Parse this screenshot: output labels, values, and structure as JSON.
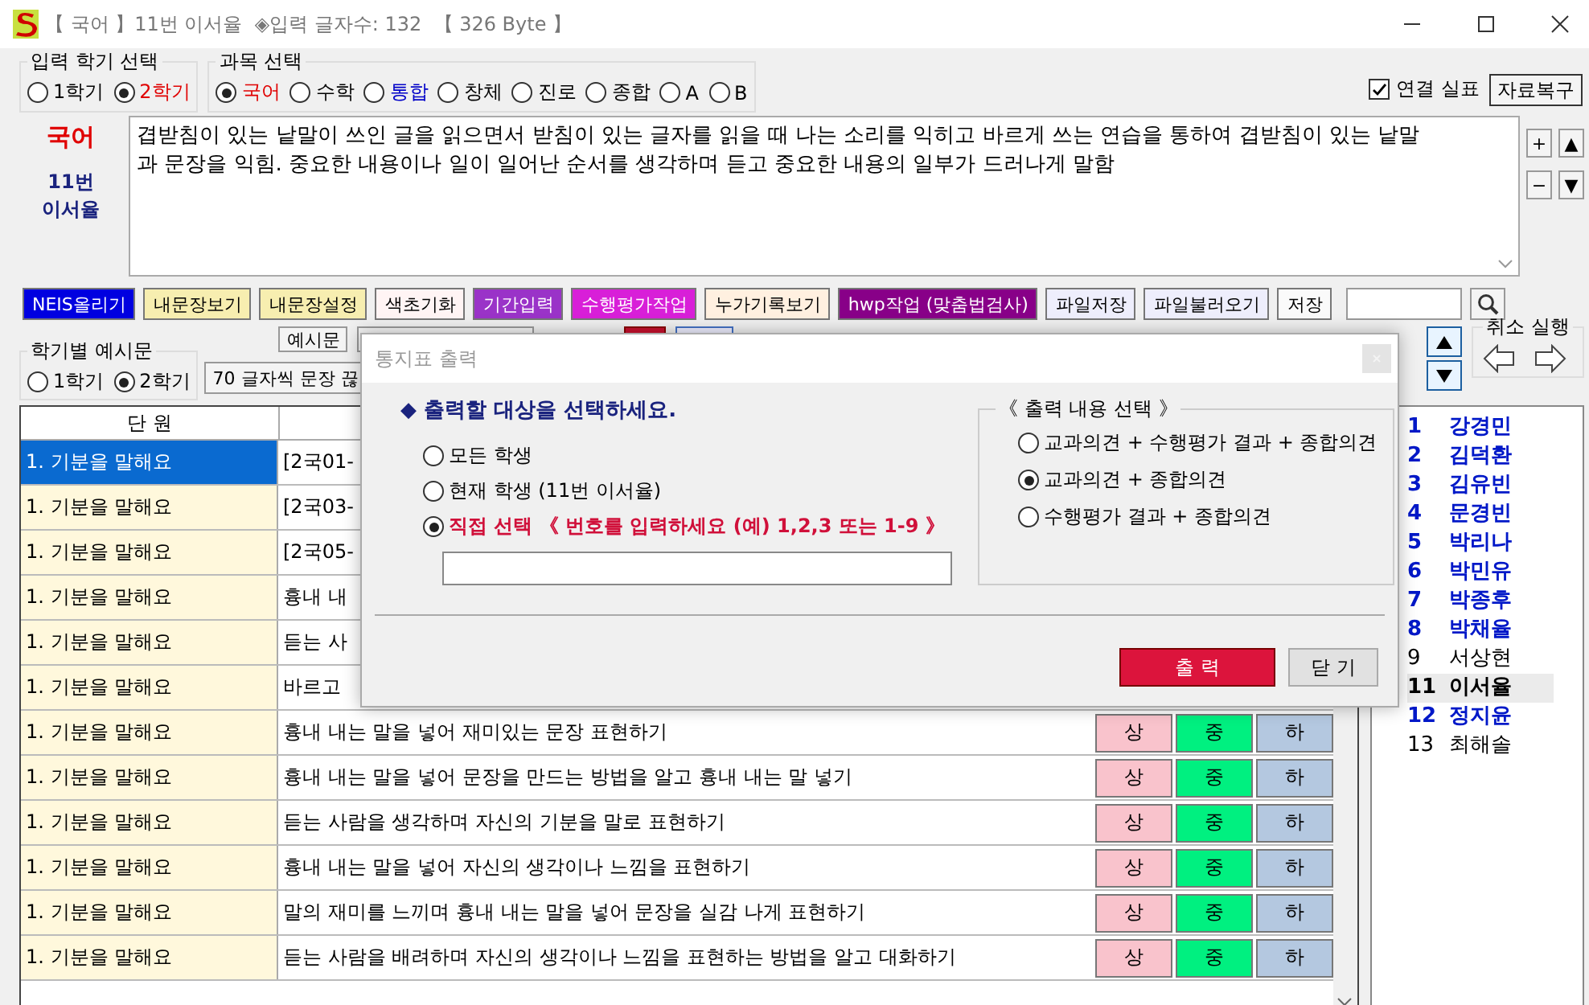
{
  "window": {
    "title": "【 국어 】11번 이서율  ◈입력 글자수: 132  【 326 Byte 】"
  },
  "semester": {
    "label": "입력 학기 선택",
    "options": [
      {
        "label": "1학기",
        "selected": false
      },
      {
        "label": "2학기",
        "selected": true
      }
    ]
  },
  "subjects": {
    "label": "과목 선택",
    "options": [
      {
        "label": "국어",
        "selected": true,
        "color": "#e00000"
      },
      {
        "label": "수학",
        "selected": false,
        "color": "#000000"
      },
      {
        "label": "통합",
        "selected": false,
        "color": "#0000c8"
      },
      {
        "label": "창체",
        "selected": false,
        "color": "#000000"
      },
      {
        "label": "진로",
        "selected": false,
        "color": "#000000"
      },
      {
        "label": "종합",
        "selected": false,
        "color": "#000000"
      },
      {
        "label": "A",
        "selected": false,
        "color": "#000000"
      },
      {
        "label": "B",
        "selected": false,
        "color": "#000000"
      }
    ]
  },
  "link_checkbox": {
    "label": "연결 실표",
    "checked": true
  },
  "restore_button": "자료복구",
  "editor": {
    "subject": "국어",
    "student_number": "11번",
    "student_name": "이서율",
    "text": "겹받침이 있는 낱말이 쓰인 글을 읽으면서 받침이 있는 글자를 읽을 때 나는 소리를 익히고 바르게 쓰는 연습을 통하여 겹받침이 있는 낱말과 문장을 익힘. 중요한 내용이나 일이 일어난 순서를 생각하며 듣고 중요한 내용의 일부가 드러나게 말함"
  },
  "side_buttons": [
    "+",
    "▲",
    "−",
    "▼"
  ],
  "toolbar": [
    {
      "label": "NEIS올리기",
      "color": "#0000e0"
    },
    {
      "label": "내문장보기",
      "color": "#f7eeb0"
    },
    {
      "label": "내문장설정",
      "color": "#f7eeb0"
    },
    {
      "label": "색초기화",
      "color": "#fff4f4"
    },
    {
      "label": "기간입력",
      "color": "#9a33c8"
    },
    {
      "label": "수행평가작업",
      "color": "#d81fd8"
    },
    {
      "label": "누가기록보기",
      "color": "#fff0e0"
    },
    {
      "label": "hwp작업 (맞춤법검사)",
      "color": "#880088"
    },
    {
      "label": "파일저장",
      "color": "#eeeefc"
    },
    {
      "label": "파일불러오기",
      "color": "#eeeefc"
    },
    {
      "label": "저장",
      "color": "#fafafa"
    }
  ],
  "example": {
    "label": "학기별 예시문",
    "options": [
      {
        "label": "1학기",
        "selected": false
      },
      {
        "label": "2학기",
        "selected": true
      }
    ]
  },
  "example_button": "예시문",
  "trim_button": "70 글자씩 문장 끊",
  "undo_group": {
    "label": "취소 실행"
  },
  "table": {
    "columns": [
      "단 원"
    ],
    "rows": [
      {
        "unit": "1. 기분을 말해요",
        "content": "[2국01-",
        "selected": true
      },
      {
        "unit": "1. 기분을 말해요",
        "content": "[2국03-",
        "selected": false
      },
      {
        "unit": "1. 기분을 말해요",
        "content": "[2국05-",
        "selected": false
      },
      {
        "unit": "1. 기분을 말해요",
        "content": "흉내 내",
        "selected": false
      },
      {
        "unit": "1. 기분을 말해요",
        "content": "듣는 사",
        "selected": false
      },
      {
        "unit": "1. 기분을 말해요",
        "content": "바르고",
        "selected": false
      },
      {
        "unit": "1. 기분을 말해요",
        "content": "흉내 내는 말을 넣어 재미있는 문장 표현하기",
        "selected": false,
        "grades": [
          {
            "label": "상",
            "color": "#f9c3cc"
          },
          {
            "label": "중",
            "color": "#00f080"
          },
          {
            "label": "하",
            "color": "#b4c8e0"
          }
        ]
      },
      {
        "unit": "1. 기분을 말해요",
        "content": "흉내 내는 말을 넣어 문장을 만드는 방법을 알고 흉내 내는 말 넣기",
        "selected": false,
        "grades": [
          {
            "label": "상",
            "color": "#f9c3cc"
          },
          {
            "label": "중",
            "color": "#00f080"
          },
          {
            "label": "하",
            "color": "#b4c8e0"
          }
        ]
      },
      {
        "unit": "1. 기분을 말해요",
        "content": "듣는 사람을 생각하며 자신의 기분을 말로 표현하기",
        "selected": false,
        "grades": [
          {
            "label": "상",
            "color": "#f9c3cc"
          },
          {
            "label": "중",
            "color": "#00f080"
          },
          {
            "label": "하",
            "color": "#b4c8e0"
          }
        ]
      },
      {
        "unit": "1. 기분을 말해요",
        "content": "흉내 내는 말을 넣어 자신의 생각이나 느낌을 표현하기",
        "selected": false,
        "grades": [
          {
            "label": "상",
            "color": "#f9c3cc"
          },
          {
            "label": "중",
            "color": "#00f080"
          },
          {
            "label": "하",
            "color": "#b4c8e0"
          }
        ]
      },
      {
        "unit": "1. 기분을 말해요",
        "content": "말의 재미를 느끼며 흉내 내는 말을 넣어 문장을 실감 나게 표현하기",
        "selected": false,
        "grades": [
          {
            "label": "상",
            "color": "#f9c3cc"
          },
          {
            "label": "중",
            "color": "#00f080"
          },
          {
            "label": "하",
            "color": "#b4c8e0"
          }
        ]
      },
      {
        "unit": "1. 기분을 말해요",
        "content": "듣는 사람을 배려하며 자신의 생각이나 느낌을 표현하는 방법을 알고 대화하기",
        "selected": false,
        "grades": [
          {
            "label": "상",
            "color": "#f9c3cc"
          },
          {
            "label": "중",
            "color": "#00f080"
          },
          {
            "label": "하",
            "color": "#b4c8e0"
          }
        ]
      }
    ]
  },
  "students": [
    {
      "number": "1",
      "name": "강경민",
      "done": true,
      "selected": false
    },
    {
      "number": "2",
      "name": "김덕환",
      "done": true,
      "selected": false
    },
    {
      "number": "3",
      "name": "김유빈",
      "done": true,
      "selected": false
    },
    {
      "number": "4",
      "name": "문경빈",
      "done": true,
      "selected": false
    },
    {
      "number": "5",
      "name": "박리나",
      "done": true,
      "selected": false
    },
    {
      "number": "6",
      "name": "박민유",
      "done": true,
      "selected": false
    },
    {
      "number": "7",
      "name": "박종후",
      "done": true,
      "selected": false
    },
    {
      "number": "8",
      "name": "박채율",
      "done": true,
      "selected": false
    },
    {
      "number": "9",
      "name": "서상현",
      "done": false,
      "selected": false
    },
    {
      "number": "11",
      "name": "이서율",
      "done": false,
      "selected": true
    },
    {
      "number": "12",
      "name": "정지윤",
      "done": true,
      "selected": false
    },
    {
      "number": "13",
      "name": "최해솔",
      "done": false,
      "selected": false
    }
  ],
  "dialog": {
    "title": "통지표 출력",
    "prompt": "◆ 출력할 대상을 선택하세요.",
    "targets": [
      {
        "label": "모든 학생",
        "selected": false
      },
      {
        "label": "현재 학생 (11번 이서율)",
        "selected": false
      },
      {
        "label": "직접 선택 《 번호를 입력하세요 (예) 1,2,3  또는 1-9 》",
        "selected": true
      }
    ],
    "content_group": {
      "label": "《 출력 내용 선택 》",
      "options": [
        {
          "label": "교과의견 + 수행평가 결과 + 종합의견",
          "selected": false
        },
        {
          "label": "교과의견 + 종합의견",
          "selected": true
        },
        {
          "label": "수행평가 결과 + 종합의견",
          "selected": false
        }
      ]
    },
    "buttons": [
      {
        "label": "출 력",
        "kind": "primary"
      },
      {
        "label": "닫 기",
        "kind": "default"
      }
    ]
  }
}
